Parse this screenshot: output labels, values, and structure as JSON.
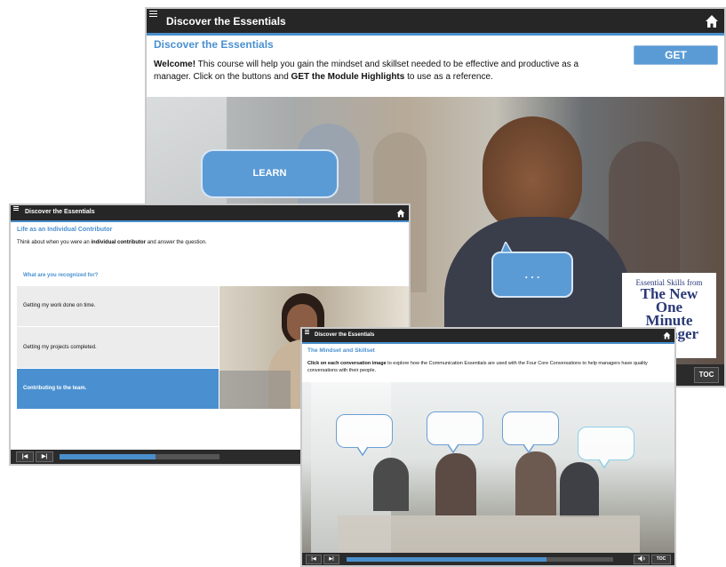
{
  "main_window": {
    "title": "Discover the Essentials",
    "heading": "Discover the Essentials",
    "intro_bold": "Welcome!",
    "intro_text_1": " This course will help you gain the mindset and skillset needed to be effective and productive as a manager. Click on the buttons and ",
    "intro_bold_2": "GET the Module Highlights",
    "intro_text_2": " to use as a reference.",
    "get_button": "GET",
    "learn_button": "LEARN",
    "ellipsis_bubble": ". . .",
    "logo": {
      "line1": "Essential Skills from",
      "line2": "The New",
      "line3": "One",
      "line4": "Minute",
      "line5": "Manager"
    },
    "toc_button": "TOC"
  },
  "left_window": {
    "title": "Discover the Essentials",
    "heading": "Life as an Individual Contributor",
    "instruction_1": "Think about when you were an ",
    "instruction_bold": "individual contributor",
    "instruction_2": " and answer the question.",
    "question": "What are you recognized for?",
    "options": [
      {
        "label": "Getting my work done on time.",
        "selected": false
      },
      {
        "label": "Getting my projects completed.",
        "selected": false
      },
      {
        "label": "Contributing to the team.",
        "selected": true
      }
    ],
    "progress": 0.6
  },
  "right_window": {
    "title": "Discover the Essentials",
    "heading": "The Mindset and Skillset",
    "instruction_bold": "Click on each conversation image",
    "instruction_text": " to explore how the Communication Essentials are used with the Four Core Conversations to help managers have quality conversations with their people.",
    "toc_button": "TOC",
    "progress": 0.75
  },
  "colors": {
    "accent": "#4a90d0",
    "titlebar": "#262626",
    "selected_option": "#4a90d0"
  }
}
